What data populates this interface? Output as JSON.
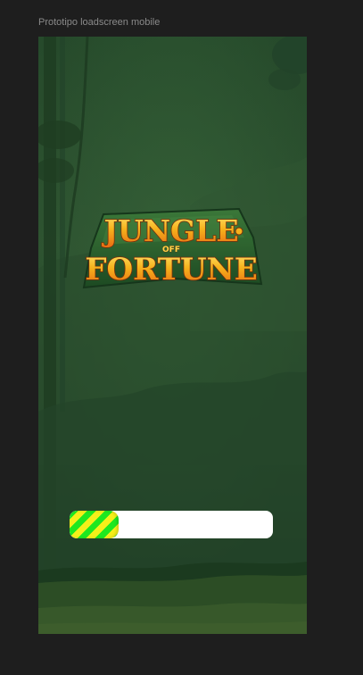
{
  "frame": {
    "label": "Prototipo loadscreen mobile"
  },
  "logo": {
    "line1": "JUNGLE",
    "line2": "OFF",
    "line3": "FORTUNE"
  },
  "loading": {
    "progress": 0.24
  },
  "colors": {
    "canvas": "#1e1e1e",
    "jungle_dark": "#1d3a21",
    "jungle_mid": "#2b4d2e",
    "logo_gold": "#f6b21c",
    "logo_orange": "#e86a12",
    "logo_green": "#2c6a2e",
    "progress_green": "#1fe81f",
    "progress_yellow": "#f5ef1a",
    "progress_track": "#ffffff"
  }
}
